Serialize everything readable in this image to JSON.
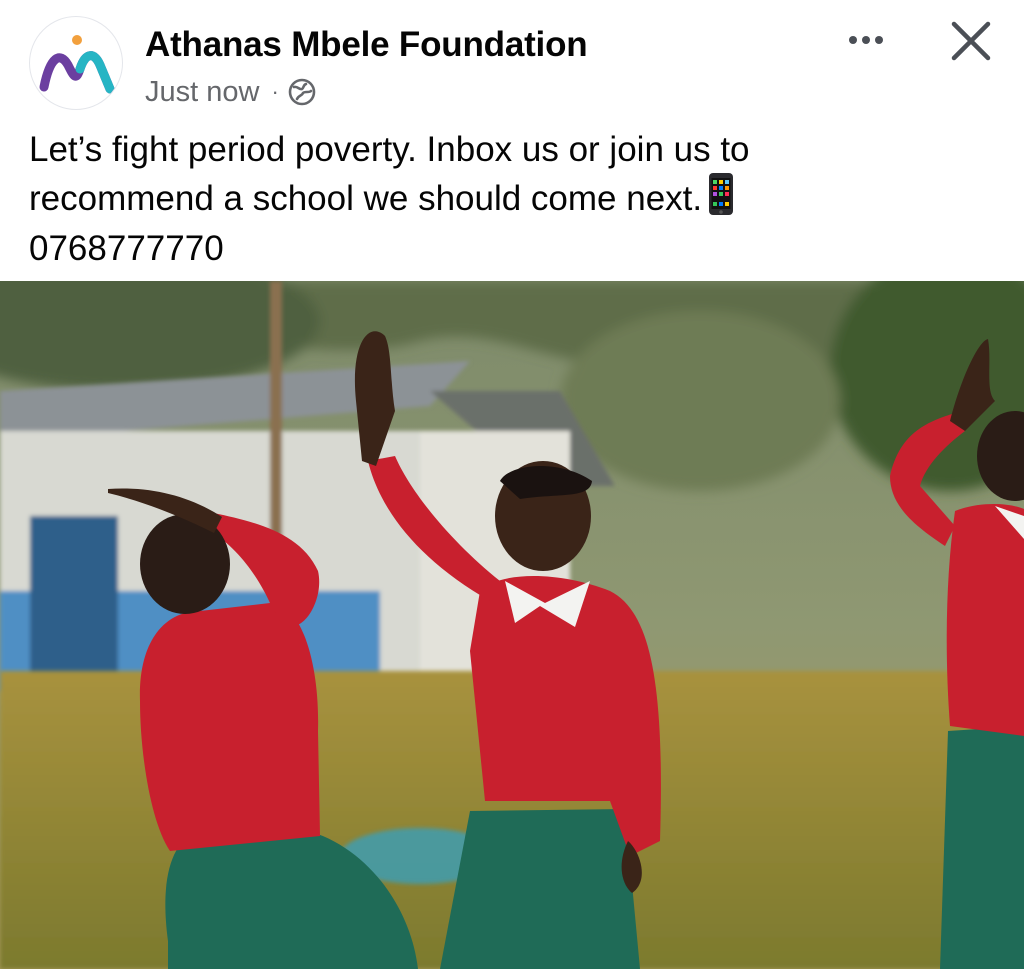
{
  "post": {
    "page_name": "Athanas Mbele Foundation",
    "timestamp": "Just now",
    "separator": "·",
    "audience_icon": "globe-icon",
    "text_lines": [
      "Let’s fight period poverty. Inbox us or join us to",
      "recommend a school we should come next.",
      "0768777770"
    ],
    "inline_emoji": "mobile-phone-icon",
    "more_icon": "more-options-icon",
    "close_icon": "close-icon",
    "image": "students-waving-photo"
  },
  "colors": {
    "name_text": "#050505",
    "meta_text": "#65676b",
    "logo_purple": "#6b3fa0",
    "logo_teal": "#26b5c4",
    "logo_orange": "#f2a03d",
    "sweater_red": "#c8202e",
    "skirt_green": "#1f6b57"
  }
}
